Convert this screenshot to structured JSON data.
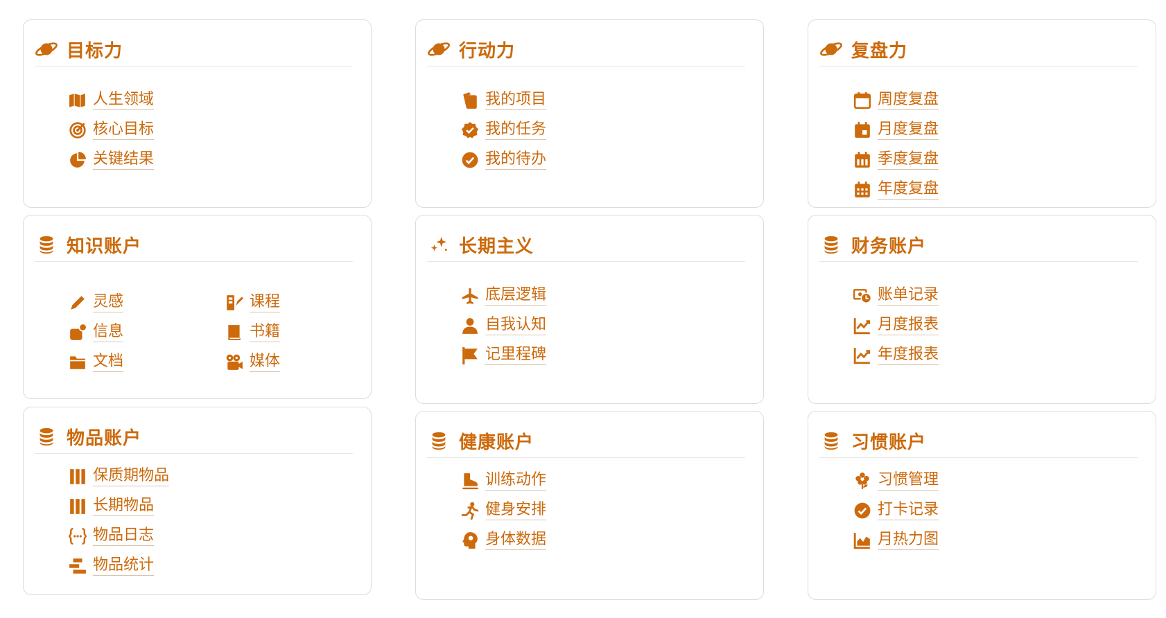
{
  "colors": {
    "accent": "#cc6a0c",
    "border": "#dcdcdc",
    "divider": "#e8e8e8"
  },
  "cards": {
    "goal": {
      "title": "目标力",
      "icon": "planet-icon",
      "items": [
        {
          "label": "人生领域",
          "icon": "map-icon"
        },
        {
          "label": "核心目标",
          "icon": "target-icon"
        },
        {
          "label": "关键结果",
          "icon": "pie-chart-icon"
        }
      ]
    },
    "action": {
      "title": "行动力",
      "icon": "planet-icon",
      "items": [
        {
          "label": "我的项目",
          "icon": "copy-icon"
        },
        {
          "label": "我的任务",
          "icon": "badge-check-icon"
        },
        {
          "label": "我的待办",
          "icon": "check-circle-icon"
        }
      ]
    },
    "review": {
      "title": "复盘力",
      "icon": "planet-icon",
      "items": [
        {
          "label": "周度复盘",
          "icon": "calendar-icon"
        },
        {
          "label": "月度复盘",
          "icon": "calendar-day-icon"
        },
        {
          "label": "季度复盘",
          "icon": "calendar-week-icon"
        },
        {
          "label": "年度复盘",
          "icon": "calendar-grid-icon"
        }
      ]
    },
    "knowledge": {
      "title": "知识账户",
      "icon": "database-icon",
      "items": [
        {
          "label": "灵感",
          "icon": "pencil-icon"
        },
        {
          "label": "课程",
          "icon": "course-icon"
        },
        {
          "label": "信息",
          "icon": "message-dot-icon"
        },
        {
          "label": "书籍",
          "icon": "book-icon"
        },
        {
          "label": "文档",
          "icon": "folder-icon"
        },
        {
          "label": "媒体",
          "icon": "video-camera-icon"
        }
      ]
    },
    "longterm": {
      "title": "长期主义",
      "icon": "sparkles-icon",
      "items": [
        {
          "label": "底层逻辑",
          "icon": "plane-icon"
        },
        {
          "label": "自我认知",
          "icon": "user-icon"
        },
        {
          "label": "记里程碑",
          "icon": "flag-icon"
        }
      ]
    },
    "finance": {
      "title": "财务账户",
      "icon": "database-icon",
      "items": [
        {
          "label": "账单记录",
          "icon": "money-clock-icon"
        },
        {
          "label": "月度报表",
          "icon": "line-chart-icon"
        },
        {
          "label": "年度报表",
          "icon": "line-chart-icon"
        }
      ]
    },
    "goods": {
      "title": "物品账户",
      "icon": "database-icon",
      "items": [
        {
          "label": "保质期物品",
          "icon": "columns-icon"
        },
        {
          "label": "长期物品",
          "icon": "columns-icon"
        },
        {
          "label": "物品日志",
          "icon": "code-brackets-icon"
        },
        {
          "label": "物品统计",
          "icon": "stacked-bars-icon"
        }
      ]
    },
    "health": {
      "title": "健康账户",
      "icon": "database-icon",
      "items": [
        {
          "label": "训练动作",
          "icon": "skate-icon"
        },
        {
          "label": "健身安排",
          "icon": "running-icon"
        },
        {
          "label": "身体数据",
          "icon": "head-brain-icon"
        }
      ]
    },
    "habit": {
      "title": "习惯账户",
      "icon": "database-icon",
      "items": [
        {
          "label": "习惯管理",
          "icon": "flower-icon"
        },
        {
          "label": "打卡记录",
          "icon": "check-circle-icon"
        },
        {
          "label": "月热力图",
          "icon": "area-chart-icon"
        }
      ]
    }
  }
}
